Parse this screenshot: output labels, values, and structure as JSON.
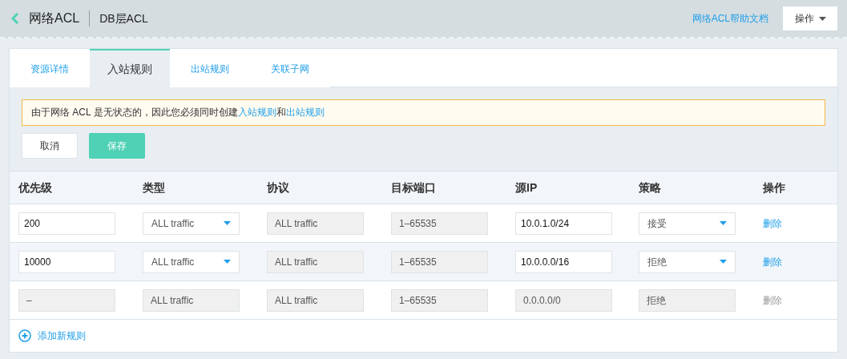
{
  "header": {
    "title": "网络ACL",
    "subtitle": "DB层ACL",
    "help_link": "网络ACL帮助文档",
    "action_button": "操作"
  },
  "tabs": [
    {
      "label": "资源详情",
      "selected": false
    },
    {
      "label": "入站规则",
      "selected": true
    },
    {
      "label": "出站规则",
      "selected": false
    },
    {
      "label": "关联子网",
      "selected": false
    }
  ],
  "notice": [
    {
      "text": "由于网络 ACL 是无状态的，因此您必须同时创建",
      "link": false
    },
    {
      "text": "入站规则",
      "link": true
    },
    {
      "text": "和",
      "link": false
    },
    {
      "text": "出站规则",
      "link": true
    }
  ],
  "buttons": [
    {
      "label": "取消",
      "kind": "default"
    },
    {
      "label": "保存",
      "kind": "primary"
    }
  ],
  "table": {
    "columns": [
      "优先级",
      "类型",
      "协议",
      "目标端口",
      "源IP",
      "策略",
      "操作"
    ],
    "rows": [
      {
        "hovered": false,
        "cells": [
          {
            "kind": "input",
            "value": "200"
          },
          {
            "kind": "select",
            "value": "ALL traffic"
          },
          {
            "kind": "readonly",
            "value": "ALL traffic"
          },
          {
            "kind": "readonly",
            "value": "1–65535"
          },
          {
            "kind": "input",
            "value": "10.0.1.0/24"
          },
          {
            "kind": "select",
            "value": "接受"
          }
        ],
        "action": {
          "label": "删除",
          "disabled": false
        }
      },
      {
        "hovered": true,
        "cells": [
          {
            "kind": "input",
            "value": "10000"
          },
          {
            "kind": "select",
            "value": "ALL traffic"
          },
          {
            "kind": "readonly",
            "value": "ALL traffic"
          },
          {
            "kind": "readonly",
            "value": "1–65535"
          },
          {
            "kind": "input",
            "value": "10.0.0.0/16"
          },
          {
            "kind": "select",
            "value": "拒绝"
          }
        ],
        "action": {
          "label": "删除",
          "disabled": false
        }
      },
      {
        "hovered": false,
        "cells": [
          {
            "kind": "readonly",
            "value": "–"
          },
          {
            "kind": "readonly",
            "value": "ALL traffic"
          },
          {
            "kind": "readonly",
            "value": "ALL traffic"
          },
          {
            "kind": "readonly",
            "value": "1–65535"
          },
          {
            "kind": "readonly",
            "value": "0.0.0.0/0"
          },
          {
            "kind": "readonly",
            "value": "拒绝"
          }
        ],
        "action": {
          "label": "删除",
          "disabled": true
        }
      }
    ]
  },
  "add_rule": "添加新规则"
}
